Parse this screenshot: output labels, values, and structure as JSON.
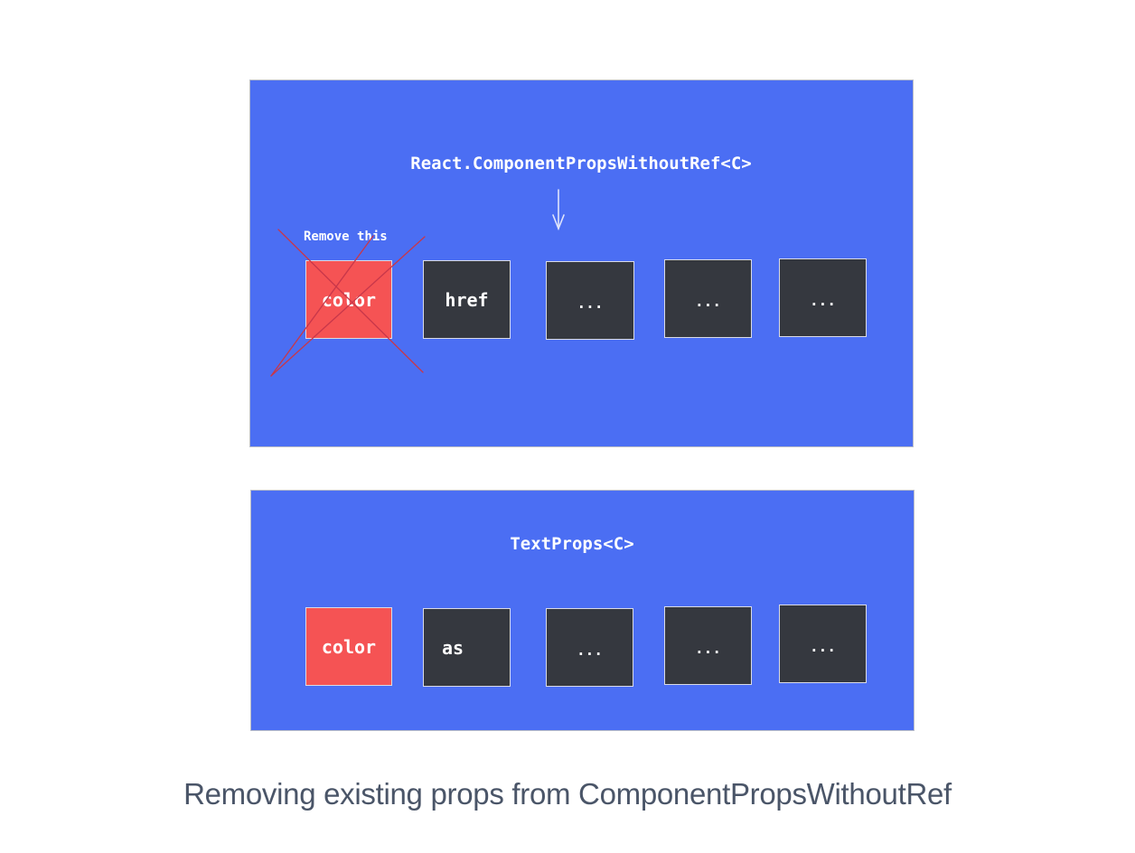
{
  "top_panel": {
    "title": "React.ComponentPropsWithoutRef<C>",
    "annotation": "Remove this",
    "boxes": [
      {
        "label": "color",
        "style": "red",
        "crossed_out": true
      },
      {
        "label": "href",
        "style": "dark"
      },
      {
        "label": "...",
        "style": "dark"
      },
      {
        "label": "...",
        "style": "dark"
      },
      {
        "label": "...",
        "style": "dark"
      }
    ]
  },
  "bottom_panel": {
    "title": "TextProps<C>",
    "boxes": [
      {
        "label": "color",
        "style": "red"
      },
      {
        "label": "as",
        "style": "dark"
      },
      {
        "label": "...",
        "style": "dark"
      },
      {
        "label": "...",
        "style": "dark"
      },
      {
        "label": "...",
        "style": "dark"
      }
    ]
  },
  "caption": "Removing existing props from ComponentPropsWithoutRef",
  "colors": {
    "panel_bg": "#4b6ef3",
    "red_box": "#f55354",
    "dark_box": "#35383f",
    "cross_line": "#c8374a",
    "text": "#ffffff",
    "caption": "#4a5568"
  }
}
